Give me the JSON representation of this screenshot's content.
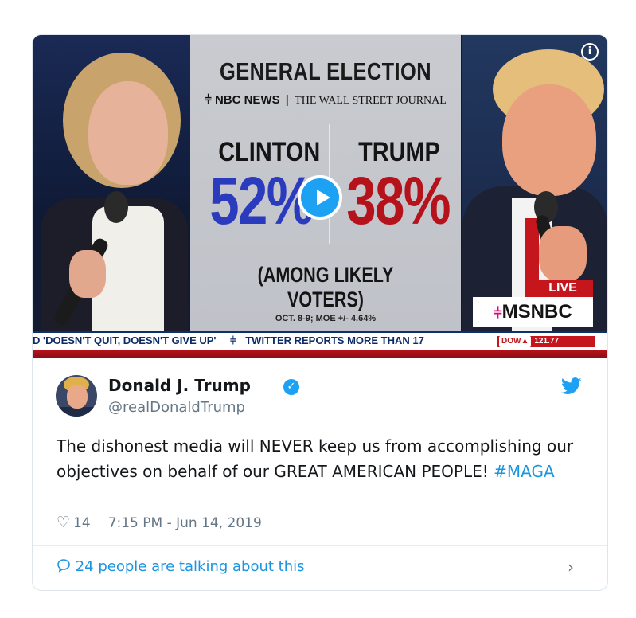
{
  "media": {
    "info_icon": "info-icon",
    "play_icon": "play-icon",
    "graphic": {
      "headline": "GENERAL ELECTION",
      "source_nbc": "NBC NEWS",
      "source_wsj": "THE WALL STREET JOURNAL",
      "left_candidate": "CLINTON",
      "left_percent": "52%",
      "right_candidate": "TRUMP",
      "right_percent": "38%",
      "subtitle": "(AMONG LIKELY VOTERS)",
      "footnote": "OCT. 8-9; MOE +/- 4.64%",
      "live_label": "LIVE",
      "network": "MSNBC"
    },
    "ticker": {
      "text": "D 'DOESN'T QUIT, DOESN'T GIVE UP'",
      "text2": "TWITTER REPORTS MORE THAN 17",
      "dow_label": "DOW",
      "dow_value": "121.77"
    },
    "colors": {
      "clinton_blue": "#2b3bbd",
      "trump_red": "#b5121b",
      "twitter_blue": "#1da1f2"
    }
  },
  "tweet": {
    "display_name": "Donald J. Trump",
    "handle": "@realDonaldTrump",
    "verified_icon": "verified-badge-icon",
    "brand_icon": "twitter-bird-icon",
    "text_main": "The dishonest media will NEVER keep us from accomplishing our objectives on behalf of our GREAT AMERICAN PEOPLE! ",
    "hashtag": "#MAGA",
    "likes": "14",
    "timestamp": "7:15 PM - Jun 14, 2019",
    "talking": "24 people are talking about this"
  }
}
